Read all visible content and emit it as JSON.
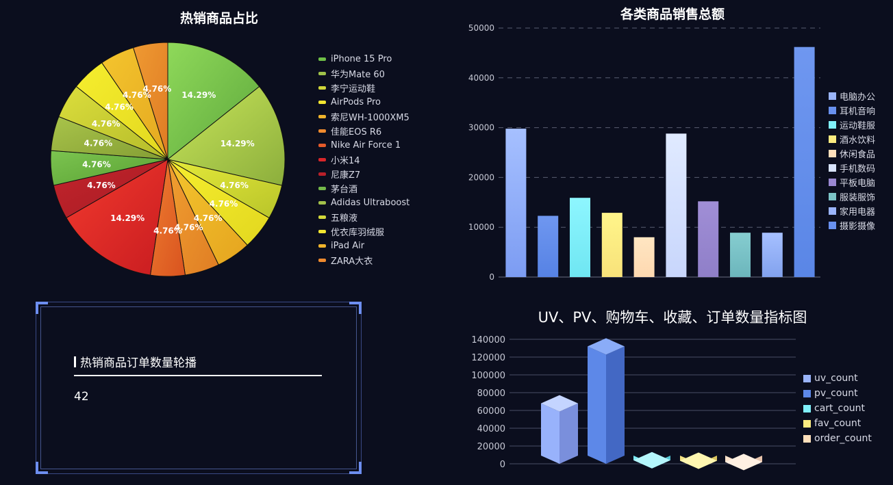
{
  "chart_data": [
    {
      "type": "pie",
      "title": "热销商品占比",
      "categories": [
        "iPhone 15 Pro",
        "华为Mate 60",
        "李宁运动鞋",
        "AirPods Pro",
        "索尼WH-1000XM5",
        "佳能EOS R6",
        "Nike Air Force 1",
        "小米14",
        "尼康Z7",
        "茅台酒",
        "Adidas Ultraboost",
        "五粮液",
        "优衣库羽绒服",
        "iPad Air",
        "ZARA大衣"
      ],
      "values": [
        14.29,
        14.29,
        4.76,
        4.76,
        4.76,
        4.76,
        4.76,
        14.29,
        4.76,
        4.76,
        4.76,
        4.76,
        4.76,
        4.76,
        4.76
      ],
      "value_labels": [
        "14.29%",
        "14.29%",
        "4.76%",
        "4.76%",
        "4.76%",
        "4.76%",
        "4.76%",
        "14.29%",
        "4.76%",
        "4.76%",
        "4.76%",
        "4.76%",
        "4.76%",
        "4.76%",
        "4.76%"
      ],
      "slice_colors": [
        [
          "#8fd95a",
          "#5ea83c"
        ],
        [
          "#c9e65a",
          "#8cae3c"
        ],
        [
          "#e6ea3a",
          "#b8c42a"
        ],
        [
          "#f6ee2e",
          "#e2d71f"
        ],
        [
          "#f4c52e",
          "#e5a41f"
        ],
        [
          "#f0a030",
          "#e07d24"
        ],
        [
          "#ee7e30",
          "#d9531f"
        ],
        [
          "#f23a2e",
          "#c81c20"
        ],
        [
          "#c4242c",
          "#a61c24"
        ],
        [
          "#7cc450",
          "#58a032"
        ],
        [
          "#a9c44a",
          "#849e34"
        ],
        [
          "#dcde3c",
          "#b4bb2a"
        ],
        [
          "#f6ee2e",
          "#e2d71f"
        ],
        [
          "#f4c52e",
          "#e4a820"
        ],
        [
          "#ef9a32",
          "#df7b24"
        ]
      ],
      "legend_colors": [
        "#6fbf47",
        "#9fc24a",
        "#cfd53a",
        "#f3e630",
        "#f0b42c",
        "#ef8a2e",
        "#e55a2a",
        "#d9262a",
        "#b8202a",
        "#74b84a",
        "#a2c04a",
        "#d2d83a",
        "#f3e630",
        "#f0b42c",
        "#ef8a2e"
      ],
      "legend_position": "right"
    },
    {
      "type": "bar",
      "title": "各类商品销售总额",
      "categories": [
        "电脑办公",
        "耳机音响",
        "运动鞋服",
        "酒水饮料",
        "休闲食品",
        "手机数码",
        "平板电脑",
        "服装服饰",
        "家用电器",
        "摄影摄像"
      ],
      "values": [
        29800,
        12300,
        15900,
        12900,
        8000,
        28800,
        15200,
        8900,
        8900,
        46200
      ],
      "ylim": [
        0,
        50000
      ],
      "yticks": [
        0,
        10000,
        20000,
        30000,
        40000,
        50000
      ],
      "grid": "dashed",
      "colors_top": [
        "#a6c0ff",
        "#6f97f0",
        "#8ef6ff",
        "#fff58a",
        "#ffe6c2",
        "#e0eaff",
        "#a08ed6",
        "#86cdd0",
        "#a6c0ff",
        "#6f97f0"
      ],
      "colors_bottom": [
        "#7c9cf2",
        "#5682e4",
        "#6fe6f2",
        "#f8e27a",
        "#fdd8b0",
        "#c8d6fc",
        "#8f7fc8",
        "#6cb6bc",
        "#82a2ee",
        "#5a86e6"
      ],
      "legend_colors": [
        "#9ab4fa",
        "#6890ee",
        "#80f0fb",
        "#fbeb80",
        "#fedfbb",
        "#d8e4fd",
        "#9a88d2",
        "#7cc4c8",
        "#9ab4fa",
        "#6890ee"
      ],
      "legend_position": "right"
    },
    {
      "type": "bar",
      "title": "UV、PV、购物车、收藏、订单数量指标图",
      "categories": [
        "uv_count",
        "pv_count",
        "cart_count",
        "fav_count",
        "order_count"
      ],
      "values": [
        68000,
        132000,
        4000,
        3500,
        2000
      ],
      "ylim": [
        0,
        140000
      ],
      "yticks": [
        0,
        20000,
        40000,
        60000,
        80000,
        100000,
        120000,
        140000
      ],
      "grid": "solid",
      "face_colors": [
        "#98b2fb",
        "#5d88e8",
        "#7de8f4",
        "#f4e284",
        "#fde3cc"
      ],
      "side_colors": [
        "#7a8fdc",
        "#4368c4",
        "#54c6d4",
        "#d8c460",
        "#e8c4ac"
      ],
      "top_colors": [
        "#c4d4ff",
        "#8aacf8",
        "#b4f6fc",
        "#fff6b0",
        "#fff0e2"
      ],
      "legend_colors": [
        "#9ab4fa",
        "#5d88e8",
        "#80f0fb",
        "#fbeb80",
        "#fedfbb"
      ],
      "legend_position": "right"
    }
  ],
  "ticker": {
    "title": "热销商品订单数量轮播",
    "value": "42"
  }
}
